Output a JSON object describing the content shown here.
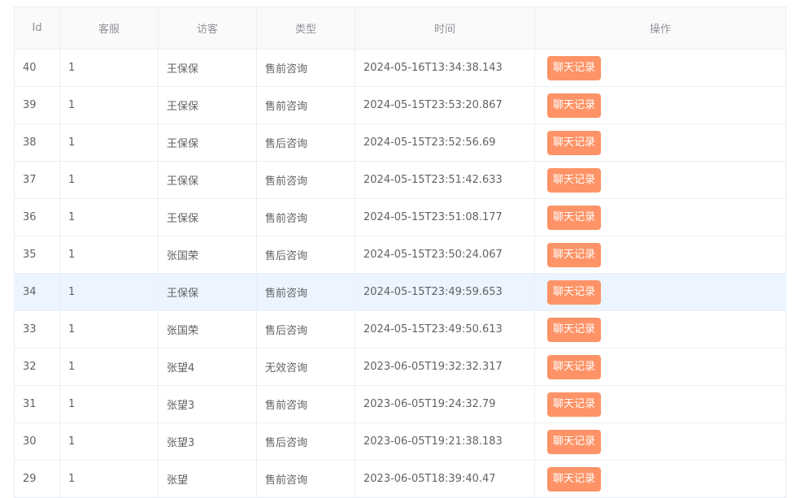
{
  "colors": {
    "accent_button": "#fd9367",
    "row_highlight": "#ecf5ff",
    "header_text": "#909399",
    "body_text": "#606266"
  },
  "table": {
    "headers": [
      "Id",
      "客服",
      "访客",
      "类型",
      "时间",
      "操作"
    ],
    "action_label": "聊天记录",
    "highlight_row_index": 6,
    "rows": [
      {
        "id": "40",
        "agent": "1",
        "visitor": "王保保",
        "type": "售前咨询",
        "time": "2024-05-16T13:34:38.143"
      },
      {
        "id": "39",
        "agent": "1",
        "visitor": "王保保",
        "type": "售前咨询",
        "time": "2024-05-15T23:53:20.867"
      },
      {
        "id": "38",
        "agent": "1",
        "visitor": "王保保",
        "type": "售后咨询",
        "time": "2024-05-15T23:52:56.69"
      },
      {
        "id": "37",
        "agent": "1",
        "visitor": "王保保",
        "type": "售前咨询",
        "time": "2024-05-15T23:51:42.633"
      },
      {
        "id": "36",
        "agent": "1",
        "visitor": "王保保",
        "type": "售前咨询",
        "time": "2024-05-15T23:51:08.177"
      },
      {
        "id": "35",
        "agent": "1",
        "visitor": "张国荣",
        "type": "售后咨询",
        "time": "2024-05-15T23:50:24.067"
      },
      {
        "id": "34",
        "agent": "1",
        "visitor": "王保保",
        "type": "售前咨询",
        "time": "2024-05-15T23:49:59.653"
      },
      {
        "id": "33",
        "agent": "1",
        "visitor": "张国荣",
        "type": "售后咨询",
        "time": "2024-05-15T23:49:50.613"
      },
      {
        "id": "32",
        "agent": "1",
        "visitor": "张望4",
        "type": "无效咨询",
        "time": "2023-06-05T19:32:32.317"
      },
      {
        "id": "31",
        "agent": "1",
        "visitor": "张望3",
        "type": "售前咨询",
        "time": "2023-06-05T19:24:32.79"
      },
      {
        "id": "30",
        "agent": "1",
        "visitor": "张望3",
        "type": "售后咨询",
        "time": "2023-06-05T19:21:38.183"
      },
      {
        "id": "29",
        "agent": "1",
        "visitor": "张望",
        "type": "售前咨询",
        "time": "2023-06-05T18:39:40.47"
      }
    ]
  }
}
